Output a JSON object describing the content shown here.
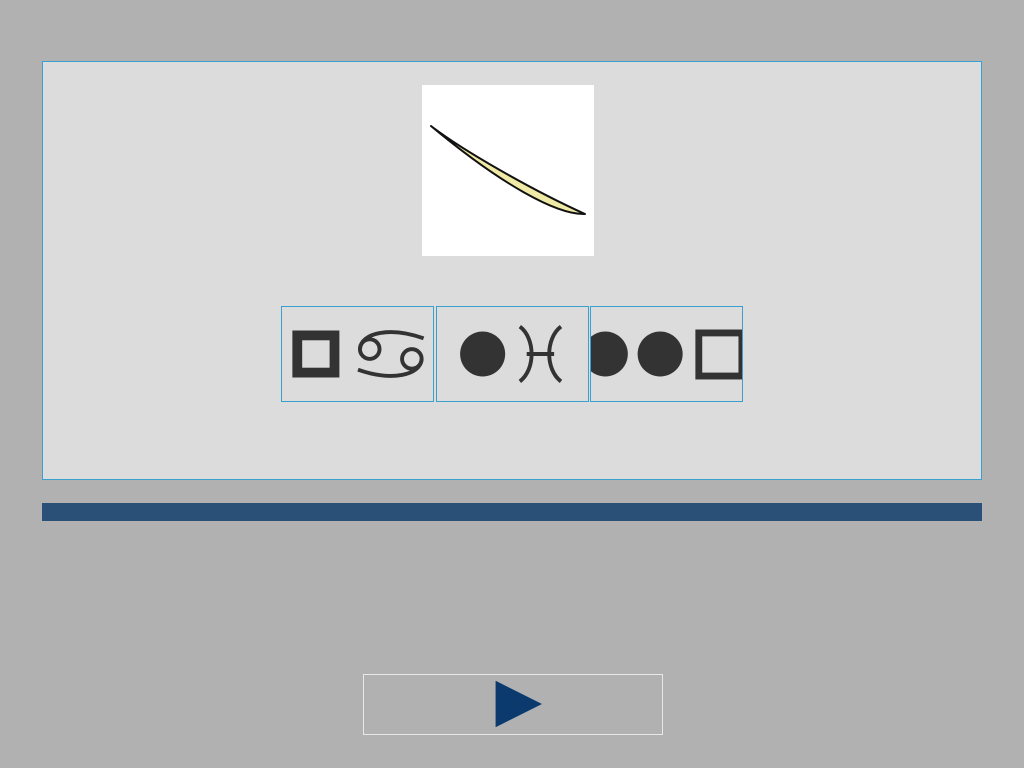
{
  "prompt": {
    "image_icon": "leaf-shape-icon",
    "image_fill": "#efeaa6",
    "image_stroke": "#111111"
  },
  "choices": [
    {
      "icon": "square-cancer-glyph-icon",
      "glyphs": [
        "filled-square",
        "cancer-symbol"
      ]
    },
    {
      "icon": "circle-pisces-glyph-icon",
      "glyphs": [
        "filled-circle",
        "pisces-symbol"
      ]
    },
    {
      "icon": "circles-square-glyph-icon",
      "glyphs": [
        "filled-circle",
        "filled-circle",
        "open-square"
      ]
    }
  ],
  "progress": {
    "fraction": 1.0
  },
  "next_button": {
    "icon": "play-triangle-icon",
    "color": "#0a3a6e"
  },
  "colors": {
    "background": "#b1b1b1",
    "panel": "#dcdcdc",
    "panel_border": "#3aa0d0",
    "progress": "#2a5078",
    "glyph": "#333333"
  }
}
